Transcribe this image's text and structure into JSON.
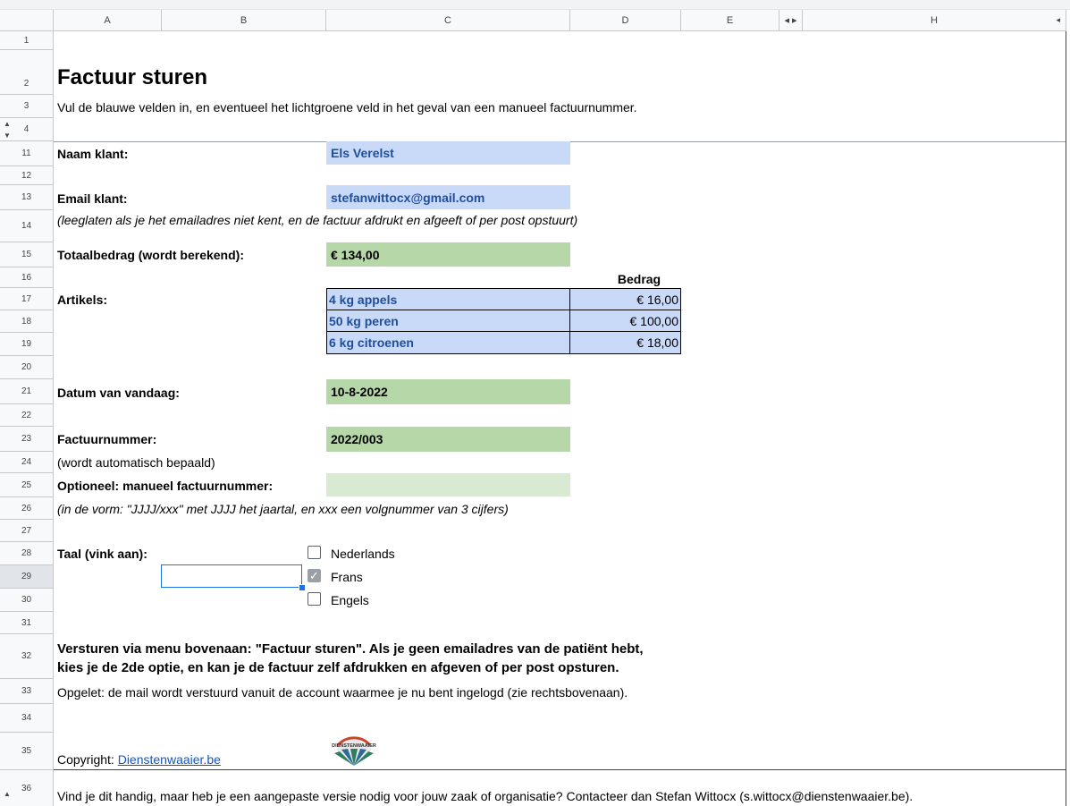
{
  "columns": {
    "a": "A",
    "b": "B",
    "c": "C",
    "d": "D",
    "e": "E",
    "h": "H",
    "arrows": "◂ ▸",
    "right_arrow": "◂"
  },
  "rows": {
    "r1": "1",
    "r2": "2",
    "r3": "3",
    "r4": "4",
    "r11": "11",
    "r12": "12",
    "r13": "13",
    "r14": "14",
    "r15": "15",
    "r16": "16",
    "r17": "17",
    "r18": "18",
    "r19": "19",
    "r20": "20",
    "r21": "21",
    "r22": "22",
    "r23": "23",
    "r24": "24",
    "r25": "25",
    "r26": "26",
    "r27": "27",
    "r28": "28",
    "r29": "29",
    "r30": "30",
    "r31": "31",
    "r32": "32",
    "r33": "33",
    "r34": "34",
    "r35": "35",
    "r36": "36"
  },
  "title": "Factuur sturen",
  "intro": "Vul de blauwe velden in, en eventueel het lichtgroene veld in het geval van een manueel factuurnummer.",
  "customer": {
    "label": "Naam klant:",
    "value": "Els Verelst"
  },
  "email": {
    "label": "Email klant:",
    "value": "stefanwittocx@gmail.com",
    "note": "(leeglaten als je het emailadres niet kent, en de factuur afdrukt en afgeeft of per post opstuurt)"
  },
  "total": {
    "label": "Totaalbedrag (wordt berekend):",
    "value": "€ 134,00"
  },
  "articles": {
    "label": "Artikels:",
    "amount_header": "Bedrag",
    "items": [
      {
        "name": "4 kg appels",
        "amount": "€ 16,00"
      },
      {
        "name": "50 kg peren",
        "amount": "€ 100,00"
      },
      {
        "name": "6 kg citroenen",
        "amount": "€ 18,00"
      }
    ]
  },
  "date": {
    "label": "Datum van vandaag:",
    "value": "10-8-2022"
  },
  "invoice": {
    "label": "Factuurnummer:",
    "value": "2022/003",
    "note": "(wordt automatisch bepaald)"
  },
  "manual_invoice": {
    "label": "Optioneel: manueel factuurnummer:",
    "value": "",
    "note": "(in de vorm: \"JJJJ/xxx\" met JJJJ het jaartal, en xxx een volgnummer van 3 cijfers)"
  },
  "language": {
    "label": "Taal (vink aan):",
    "options": [
      {
        "label": "Nederlands",
        "checked": false
      },
      {
        "label": "Frans",
        "checked": true
      },
      {
        "label": "Engels",
        "checked": false
      }
    ]
  },
  "send_instructions": {
    "line1": "Versturen via menu bovenaan: \"Factuur sturen\". Als je geen emailadres van de patiënt hebt,",
    "line2": "kies je de 2de optie, en kan je de factuur zelf afdrukken en afgeven of per post opsturen."
  },
  "warning": "Opgelet: de mail wordt verstuurd vanuit de account waarmee je nu bent ingelogd (zie rechtsbovenaan).",
  "copyright": {
    "label": "Copyright: ",
    "link": "Dienstenwaaier.be",
    "logo_text": "DIENSTENWAAIER"
  },
  "footer": "Vind je dit handig, maar heb je een aangepaste versie nodig voor jouw zaak of organisatie? Contacteer dan Stefan Wittocx (s.wittocx@dienstenwaaier.be).",
  "colors": {
    "blue_field": "#c9daf8",
    "green_field": "#b6d7a8",
    "light_green_field": "#d9ead3",
    "selection": "#1a73e8"
  }
}
